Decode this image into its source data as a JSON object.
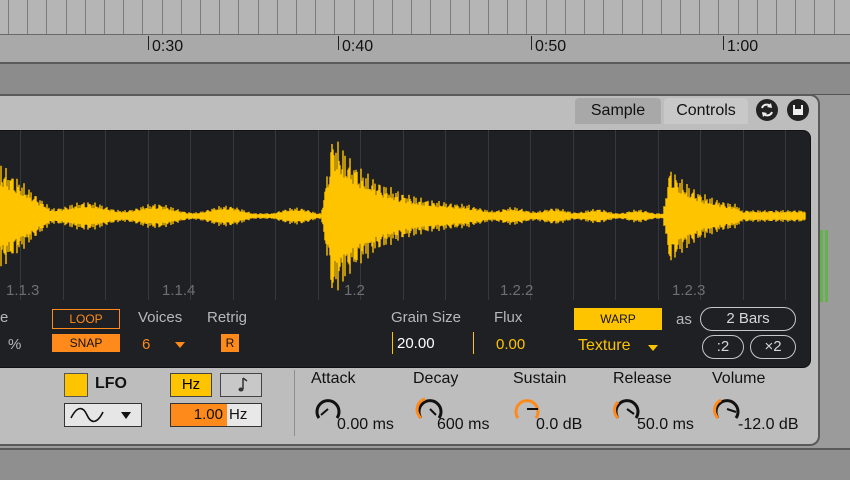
{
  "ruler": {
    "markers": [
      "0:30",
      "0:40",
      "0:50",
      "1:00"
    ]
  },
  "tabs": {
    "sample": "Sample",
    "controls": "Controls"
  },
  "header_icons": [
    "hot-swap-icon",
    "save-icon"
  ],
  "waveform": {
    "color": "#ffc400",
    "bar_markers": [
      "1.1.3",
      "1.1.4",
      "1.2",
      "1.2.2",
      "1.2.3"
    ]
  },
  "sample_controls": {
    "left_partial_label": "e",
    "left_partial_value": "%",
    "loop_label": "LOOP",
    "snap_label": "SNAP",
    "voices_label": "Voices",
    "voices_value": "6",
    "retrig_label": "Retrig",
    "retrig_button": "R",
    "grain_size_label": "Grain Size",
    "grain_size_value": "20.00",
    "flux_label": "Flux",
    "flux_value": "0.00",
    "warp_label": "WARP",
    "as_label": "as",
    "warp_length": "2 Bars",
    "warp_mode": "Texture",
    "half_button": ":2",
    "double_button": "×2"
  },
  "lfo": {
    "label": "LFO",
    "hz_button": "Hz",
    "sync_icon": "note-icon",
    "waveform_icon": "sine-wave-icon",
    "rate_value": "1.00",
    "rate_unit": "Hz"
  },
  "envelope": {
    "attack": {
      "label": "Attack",
      "value": "0.00 ms"
    },
    "decay": {
      "label": "Decay",
      "value": "600 ms"
    },
    "sustain": {
      "label": "Sustain",
      "value": "0.0 dB"
    },
    "release": {
      "label": "Release",
      "value": "50.0 ms"
    },
    "volume": {
      "label": "Volume",
      "value": "-12.0 dB"
    }
  },
  "colors": {
    "accent_yellow": "#ffc400",
    "accent_orange": "#ff8a1c",
    "display_bg": "#1e2023",
    "panel_bg": "#bdbdbd"
  }
}
